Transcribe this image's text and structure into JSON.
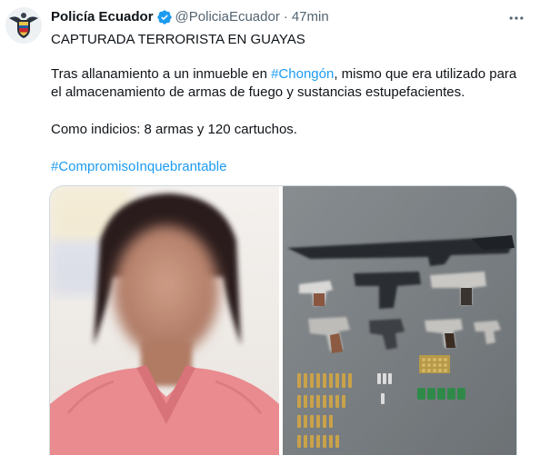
{
  "tweet": {
    "author_name": "Policía Ecuador",
    "handle": "@PoliciaEcuador",
    "separator": "·",
    "time": "47min",
    "title": "CAPTURADA TERRORISTA EN GUAYAS",
    "p1_before": "Tras allanamiento a un inmueble en ",
    "p1_link": "#Chongón",
    "p1_after": ", mismo que era utilizado para el almacenamiento de armas de fuego y sustancias estupefacientes.",
    "p2": "Como indicios: 8 armas y 120 cartuchos.",
    "hashtag": "#CompromisoInquebrantable"
  },
  "colors": {
    "link": "#1d9bf0",
    "verified": "#1d9bf0",
    "secondary_text": "#536471"
  },
  "icons": {
    "avatar": "police-shield-icon",
    "verified": "verified-badge-icon",
    "more": "more-options-icon"
  }
}
